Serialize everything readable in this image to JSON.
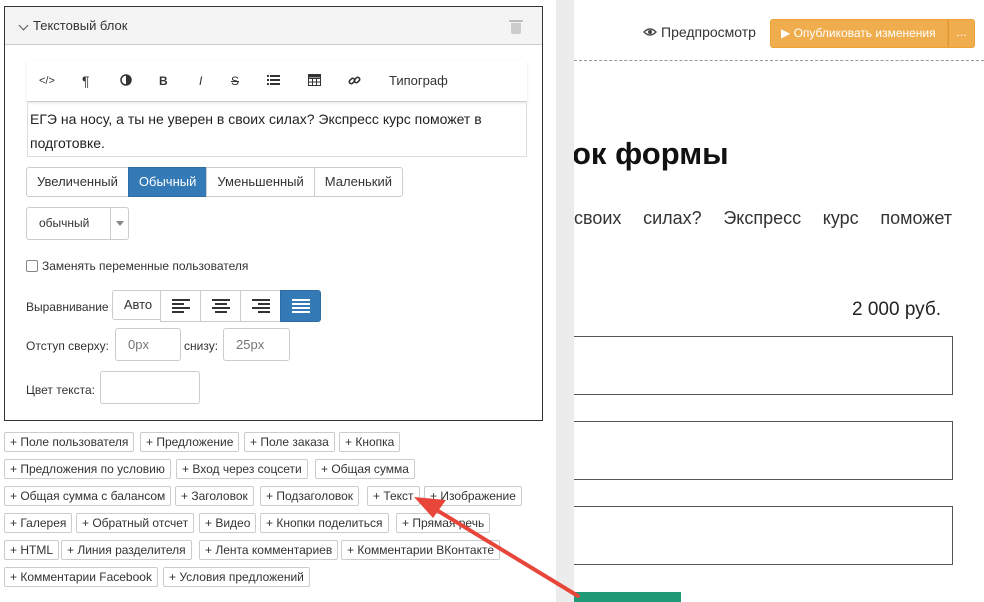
{
  "panel": {
    "title": "Текстовый блок",
    "toolbar": {
      "code": "</>",
      "paragraph": "¶",
      "bold": "B",
      "italic": "I",
      "strike": "S",
      "typograph": "Типограф"
    },
    "editor_text": "ЕГЭ на носу, а ты не уверен в своих силах? Экспресс курс поможет в подготовке.",
    "size_options": [
      "Увеличенный",
      "Обычный",
      "Уменьшенный",
      "Маленький"
    ],
    "size_selected": "Обычный",
    "weight_value": "обычный",
    "checkbox_label": "Заменять переменные пользователя",
    "align_label": "Выравнивание",
    "align_auto": "Авто",
    "align_selected": "justify",
    "indent_top_label": "Отступ сверху:",
    "indent_top_placeholder": "0px",
    "indent_bottom_label": "снизу:",
    "indent_bottom_placeholder": "25px",
    "text_color_label": "Цвет текста:"
  },
  "add_buttons": [
    "+ Поле пользователя",
    "+ Предложение",
    "+ Поле заказа",
    "+ Кнопка",
    "+ Предложения по условию",
    "+ Вход через соцсети",
    "+ Общая сумма",
    "+ Общая сумма с балансом",
    "+ Заголовок",
    "+ Подзаголовок",
    "+ Текст",
    "+ Изображение",
    "+ Галерея",
    "+ Обратный отсчет",
    "+ Видео",
    "+ Кнопки поделиться",
    "+ Прямая речь",
    "+ HTML",
    "+ Линия разделителя",
    "+ Лента комментариев",
    "+ Комментарии ВКонтакте",
    "+ Комментарии Facebook",
    "+ Условия предложений"
  ],
  "header": {
    "preview": "Предпросмотр",
    "publish": "▶ Опубликовать изменения",
    "more": "..."
  },
  "page": {
    "heading": "ок формы",
    "desc": "своих силах? Экспресс курс поможет",
    "price": "2 000 руб."
  },
  "colors": {
    "primary": "#337ab7",
    "publish": "#f0ad4e",
    "arrow": "#e8463a",
    "submit": "#1e9a77"
  }
}
